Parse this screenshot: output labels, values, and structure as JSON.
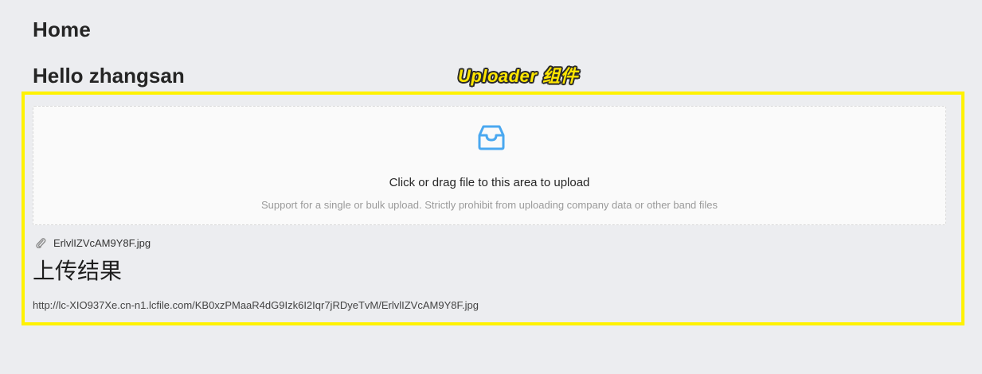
{
  "header": {
    "title": "Home",
    "greeting": "Hello zhangsan"
  },
  "annotation": {
    "label": "Uploader 组件",
    "color": "#fff200"
  },
  "uploader": {
    "icon": "inbox-icon",
    "main_text": "Click or drag file to this area to upload",
    "hint_text": "Support for a single or bulk upload. Strictly prohibit from uploading company data or other band files",
    "accent_color": "#4aa8f0"
  },
  "file_list": [
    {
      "icon": "paperclip-icon",
      "name": "ErlvlIZVcAM9Y8F.jpg"
    }
  ],
  "result": {
    "title": "上传结果",
    "url": "http://lc-XIO937Xe.cn-n1.lcfile.com/KB0xzPMaaR4dG9Izk6I2Iqr7jRDyeTvM/ErlvlIZVcAM9Y8F.jpg"
  }
}
